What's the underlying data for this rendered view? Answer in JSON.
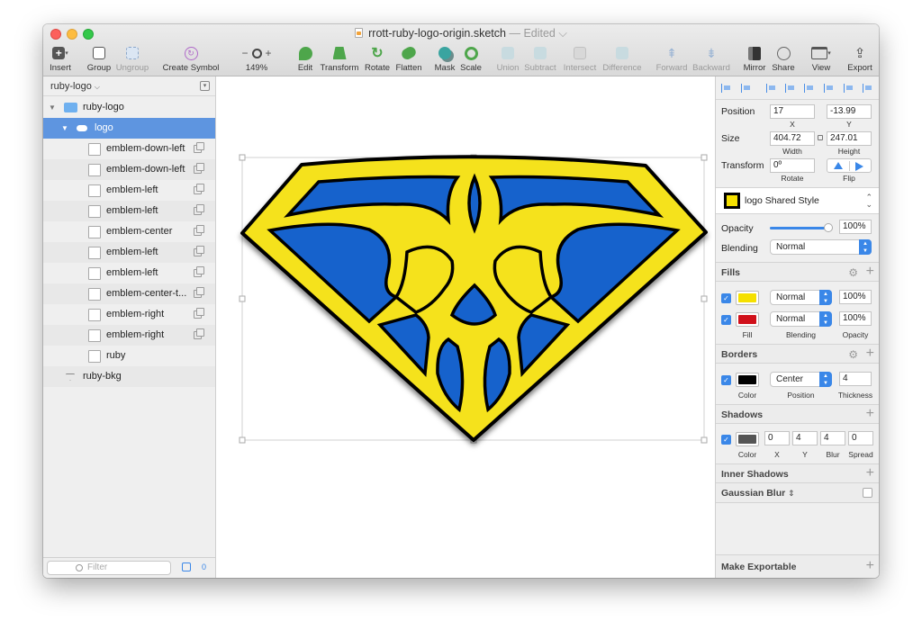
{
  "window": {
    "title": "rrott-ruby-logo-origin.sketch",
    "status": "Edited"
  },
  "toolbar": {
    "insert": "Insert",
    "group": "Group",
    "ungroup": "Ungroup",
    "create_symbol": "Create Symbol",
    "zoom_minus": "−",
    "zoom_plus": "+",
    "zoom": "149%",
    "edit": "Edit",
    "transform": "Transform",
    "rotate": "Rotate",
    "flatten": "Flatten",
    "mask": "Mask",
    "scale": "Scale",
    "union": "Union",
    "subtract": "Subtract",
    "intersect": "Intersect",
    "difference": "Difference",
    "forward": "Forward",
    "backward": "Backward",
    "mirror": "Mirror",
    "share": "Share",
    "view": "View",
    "export": "Export"
  },
  "sidebar": {
    "page": "ruby-logo",
    "layers": [
      {
        "name": "ruby-logo",
        "level": 0
      },
      {
        "name": "logo",
        "level": 1,
        "selected": true
      },
      {
        "name": "emblem-down-left",
        "level": 2
      },
      {
        "name": "emblem-down-left",
        "level": 2
      },
      {
        "name": "emblem-left",
        "level": 2
      },
      {
        "name": "emblem-left",
        "level": 2
      },
      {
        "name": "emblem-center",
        "level": 2
      },
      {
        "name": "emblem-left",
        "level": 2
      },
      {
        "name": "emblem-left",
        "level": 2
      },
      {
        "name": "emblem-center-t...",
        "level": 2
      },
      {
        "name": "emblem-right",
        "level": 2
      },
      {
        "name": "emblem-right",
        "level": 2
      },
      {
        "name": "ruby",
        "level": 2
      },
      {
        "name": "ruby-bkg",
        "level": 0
      }
    ],
    "filter_placeholder": "Filter",
    "slice_count": "0"
  },
  "inspector": {
    "position_label": "Position",
    "x": "17",
    "y": "-13.99",
    "x_label": "X",
    "y_label": "Y",
    "size_label": "Size",
    "width": "404.72",
    "height": "247.01",
    "width_label": "Width",
    "height_label": "Height",
    "transform_label": "Transform",
    "rotate": "0º",
    "rotate_label": "Rotate",
    "flip_label": "Flip",
    "shared_style": "logo Shared Style",
    "opacity_label": "Opacity",
    "opacity": "100%",
    "opacity_fraction": 1.0,
    "blending_label": "Blending",
    "blending": "Normal",
    "fills_title": "Fills",
    "fills": [
      {
        "color": "#f5e000",
        "blending": "Normal",
        "opacity": "100%"
      },
      {
        "color": "#d0101a",
        "blending": "Normal",
        "opacity": "100%"
      }
    ],
    "fill_col": "Fill",
    "blending_col": "Blending",
    "opacity_col": "Opacity",
    "borders_title": "Borders",
    "border": {
      "color": "#000000",
      "position": "Center",
      "thickness": "4"
    },
    "color_col": "Color",
    "position_col": "Position",
    "thickness_col": "Thickness",
    "shadows_title": "Shadows",
    "shadow": {
      "color": "#555555",
      "x": "0",
      "y": "4",
      "blur": "4",
      "spread": "0"
    },
    "shadow_cols": {
      "color": "Color",
      "x": "X",
      "y": "Y",
      "blur": "Blur",
      "spread": "Spread"
    },
    "inner_shadows_title": "Inner Shadows",
    "gaussian_blur_title": "Gaussian Blur",
    "make_exportable": "Make Exportable"
  },
  "colors": {
    "yellow": "#f7e01a",
    "blue": "#1762cc",
    "selection": "#5e95e0"
  }
}
